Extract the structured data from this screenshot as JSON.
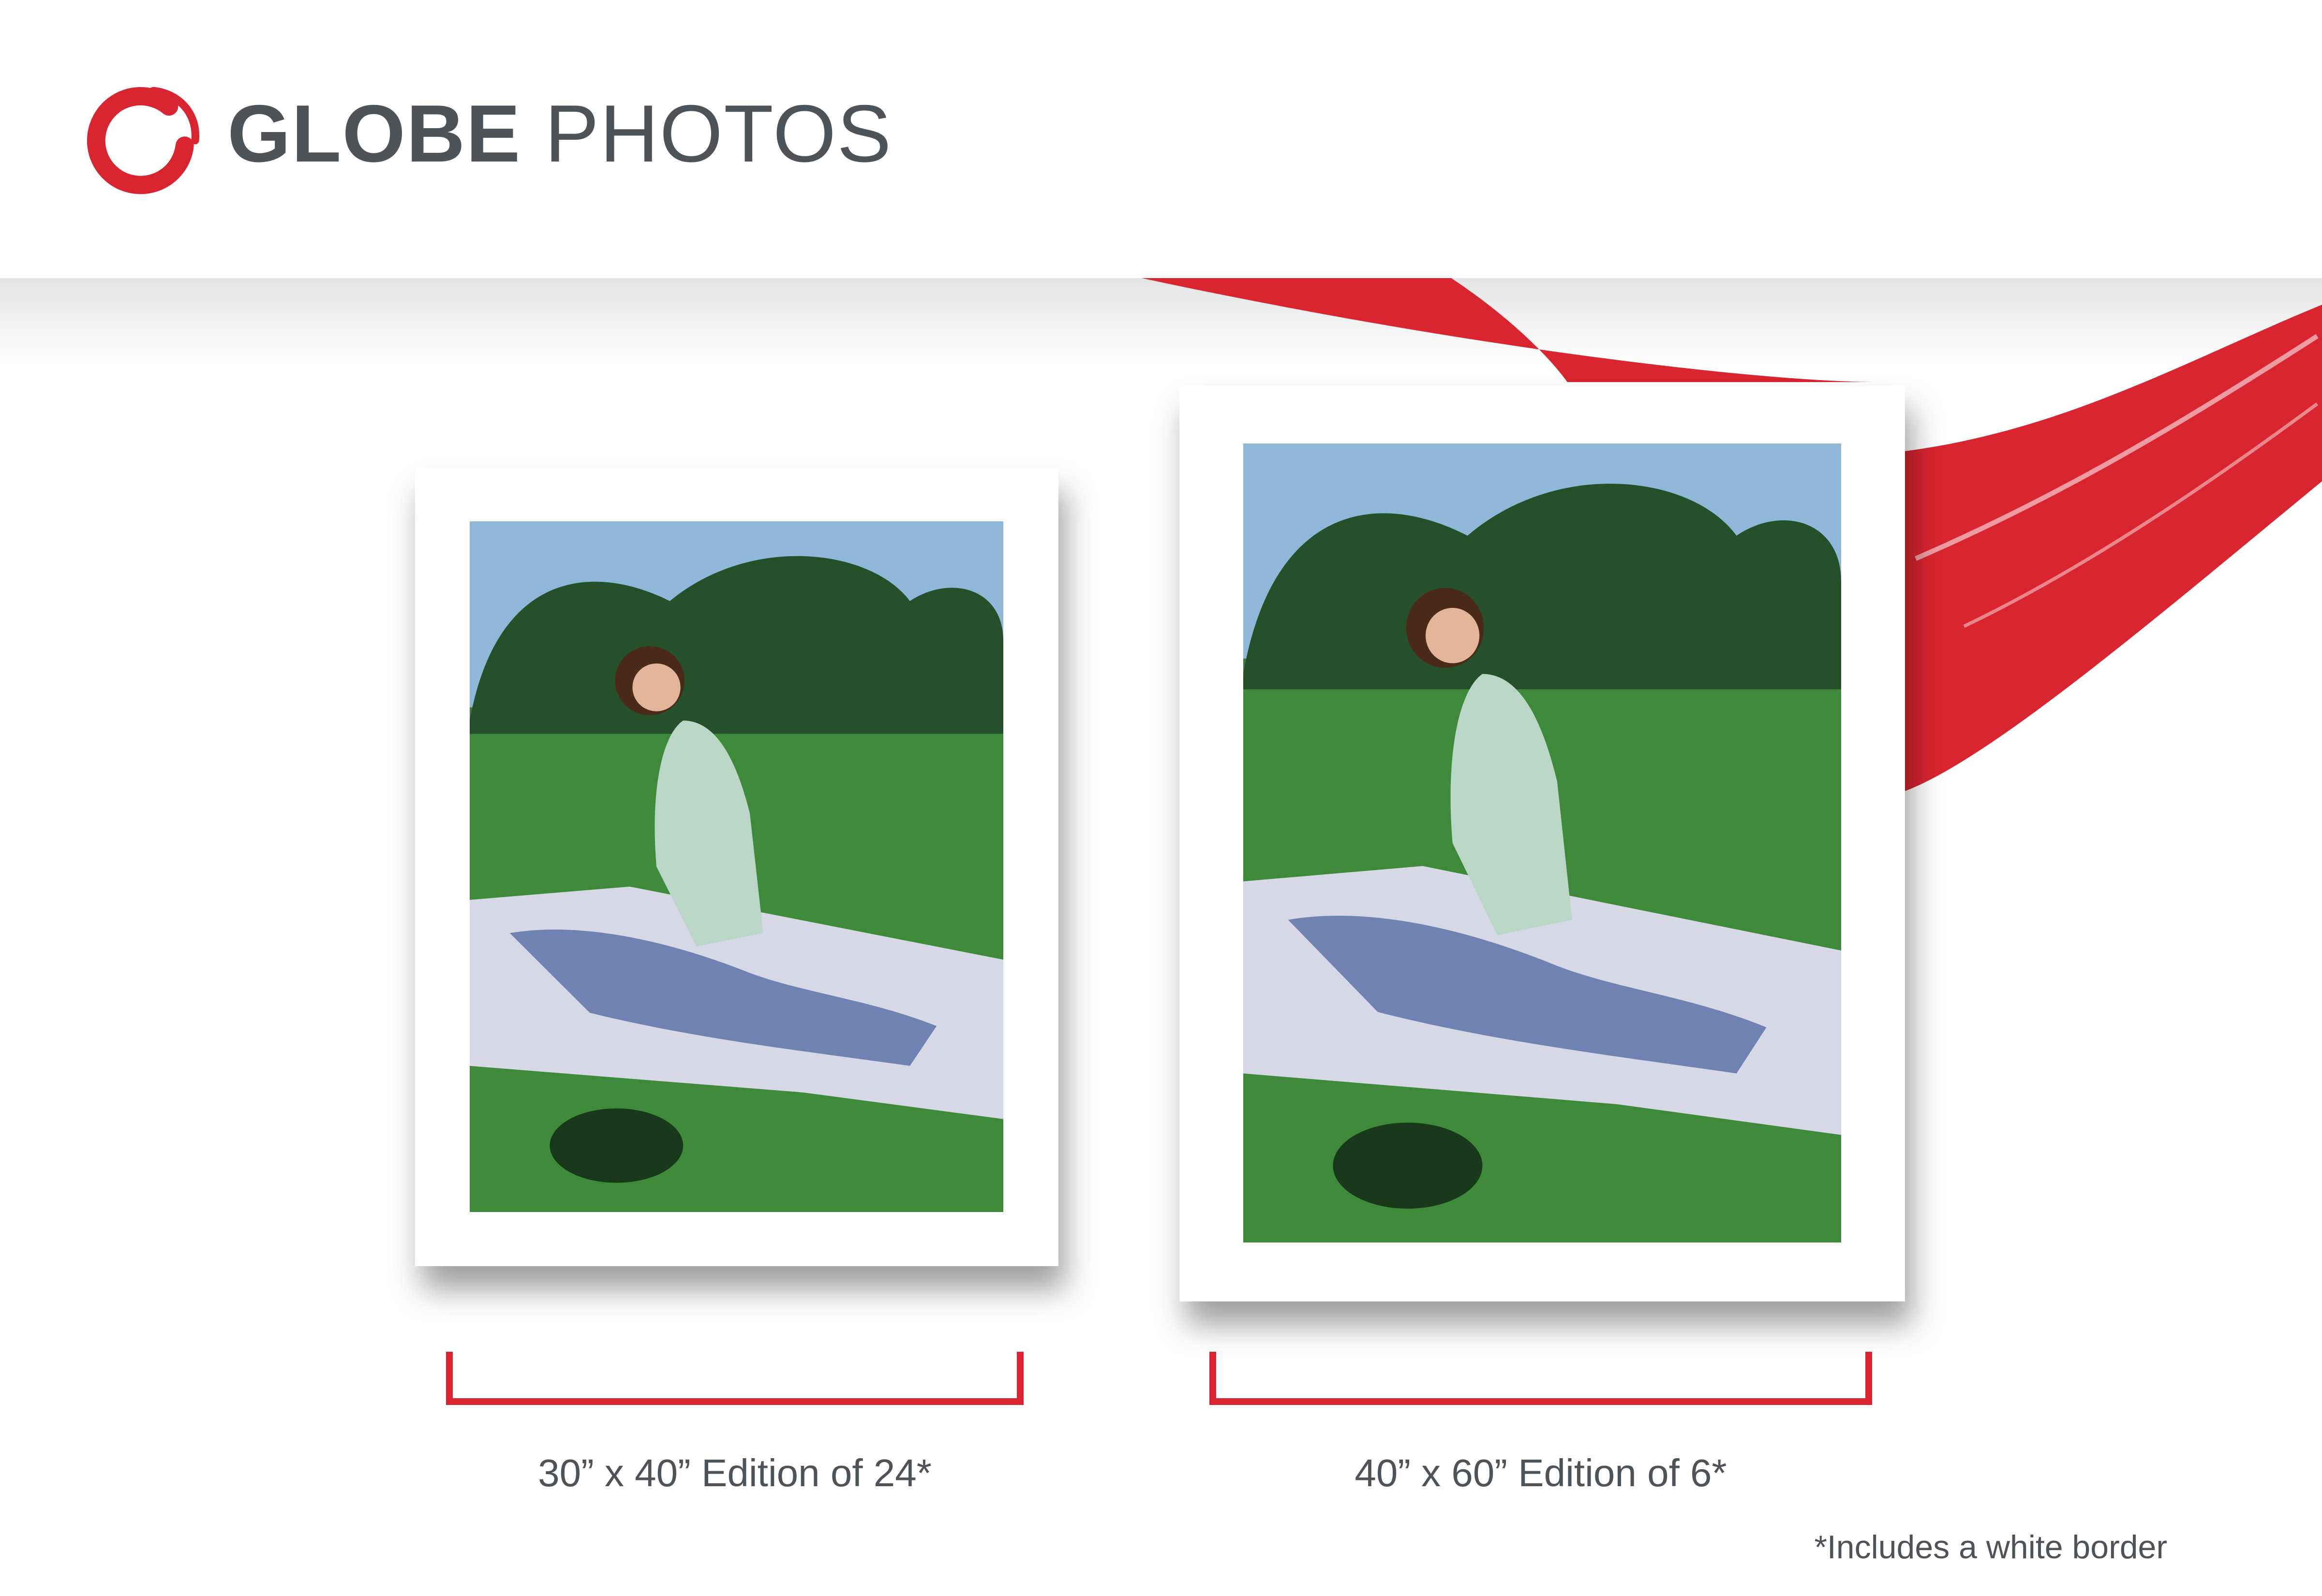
{
  "brand": {
    "name_bold": "GLOBE",
    "name_light": "PHOTOS",
    "logo_icon": "red-brush-circle-icon",
    "accent_color": "#d9252f",
    "text_color": "#4e5357"
  },
  "prints": [
    {
      "size_label": "30” x 40” Edition of 24*"
    },
    {
      "size_label": "40” x 60” Edition of 6*"
    }
  ],
  "footnote": "*Includes a white border"
}
